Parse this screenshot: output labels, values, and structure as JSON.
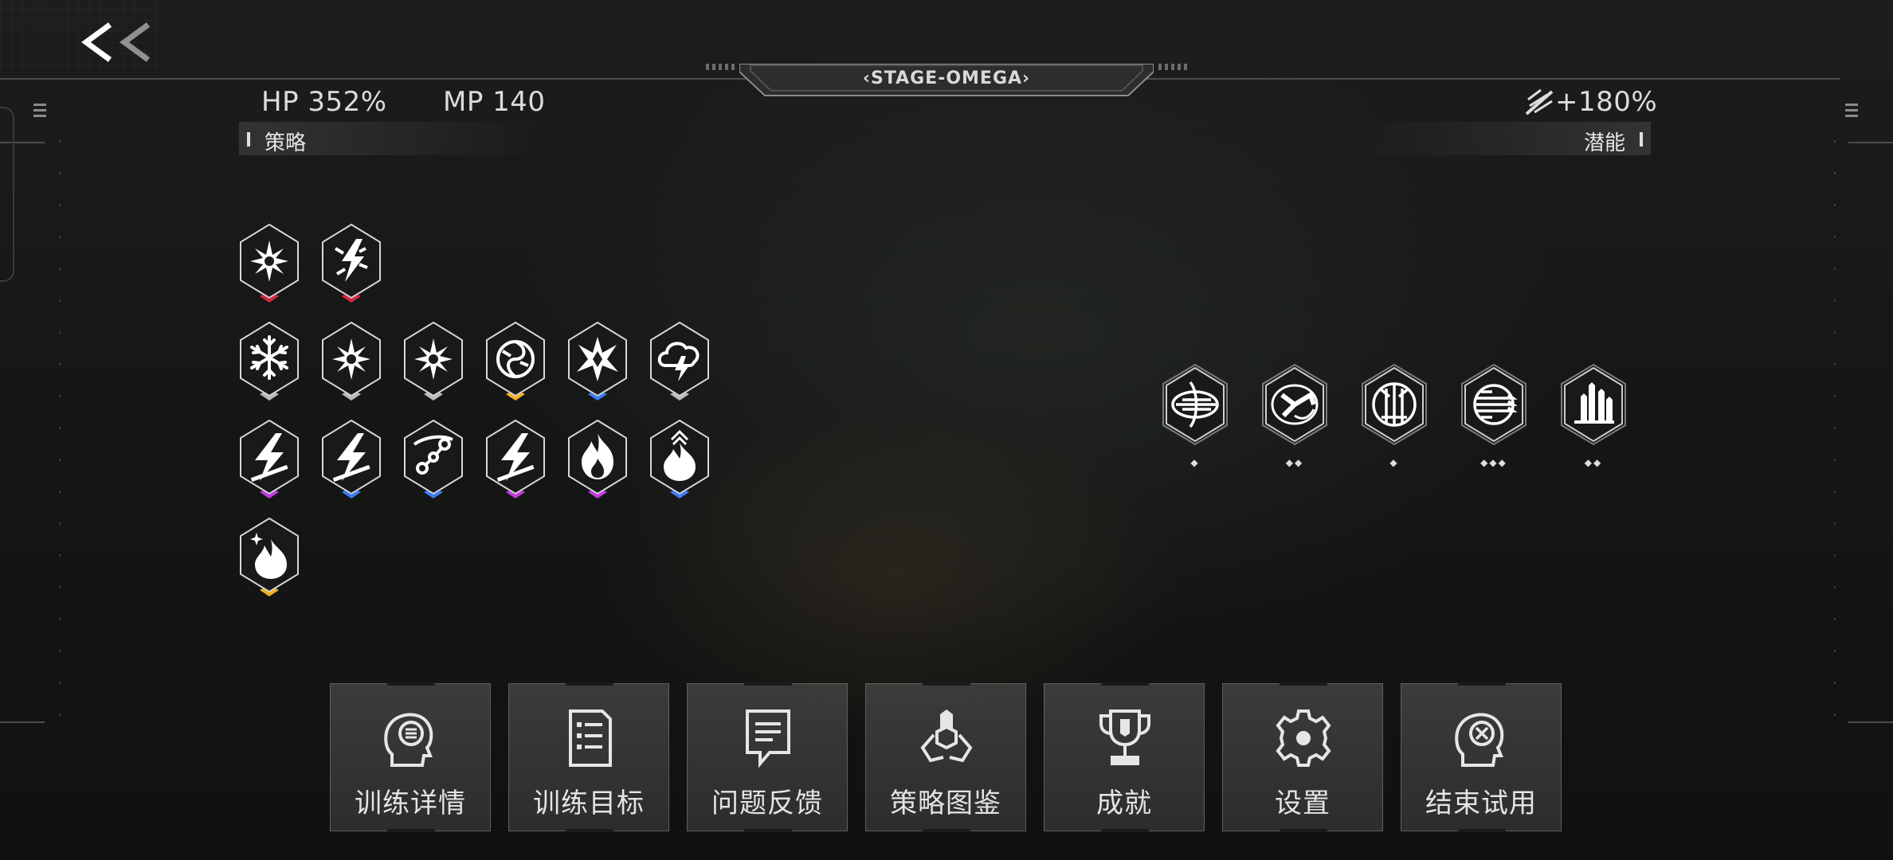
{
  "nav": {
    "back_icon": "double-chevron-left-icon"
  },
  "stage": {
    "title": "‹STAGE-OMEGA›"
  },
  "stats": {
    "hp": "HP 352%",
    "mp": "MP 140",
    "potential_bonus": "+180%",
    "potential_icon": "slash-burst-icon"
  },
  "sections": {
    "strategy_label": "策略",
    "potential_label": "潜能"
  },
  "colors": {
    "red": "#d4283c",
    "silver": "#bcbcbc",
    "gold": "#f0b321",
    "blue": "#3d7cf2",
    "magenta": "#c43ae0"
  },
  "strategies": [
    {
      "icon": "ice-burst-icon",
      "rarity": "red"
    },
    {
      "icon": "lightning-cross-icon",
      "rarity": "red"
    },
    {
      "icon": "snowflake-icon",
      "rarity": "silver"
    },
    {
      "icon": "ice-burst-icon",
      "rarity": "silver"
    },
    {
      "icon": "ice-burst-icon",
      "rarity": "silver"
    },
    {
      "icon": "spiral-storm-icon",
      "rarity": "gold"
    },
    {
      "icon": "ice-star-icon",
      "rarity": "blue"
    },
    {
      "icon": "thunder-cloud-icon",
      "rarity": "silver"
    },
    {
      "icon": "lightning-bolt-icon",
      "rarity": "magenta"
    },
    {
      "icon": "lightning-bolt-icon",
      "rarity": "blue"
    },
    {
      "icon": "chain-link-icon",
      "rarity": "blue"
    },
    {
      "icon": "lightning-bolt-icon",
      "rarity": "magenta"
    },
    {
      "icon": "flame-icon",
      "rarity": "magenta"
    },
    {
      "icon": "flame-up-icon",
      "rarity": "blue"
    },
    {
      "icon": "flame-sparkle-icon",
      "rarity": "gold"
    }
  ],
  "potentials": [
    {
      "icon": "blade-shield-icon",
      "level": "◆"
    },
    {
      "icon": "running-figure-icon",
      "level": "◆◆"
    },
    {
      "icon": "twin-blades-icon",
      "level": "◆"
    },
    {
      "icon": "speed-blades-icon",
      "level": "◆◆◆"
    },
    {
      "icon": "towers-icon",
      "level": "◆◆"
    }
  ],
  "menu": [
    {
      "label": "训练详情",
      "icon": "head-chat-icon"
    },
    {
      "label": "训练目标",
      "icon": "list-document-icon"
    },
    {
      "label": "问题反馈",
      "icon": "feedback-document-icon"
    },
    {
      "label": "策略图鉴",
      "icon": "strategy-atlas-icon"
    },
    {
      "label": "成就",
      "icon": "trophy-icon"
    },
    {
      "label": "设置",
      "icon": "gear-icon"
    },
    {
      "label": "结束试用",
      "icon": "head-cross-icon"
    }
  ]
}
